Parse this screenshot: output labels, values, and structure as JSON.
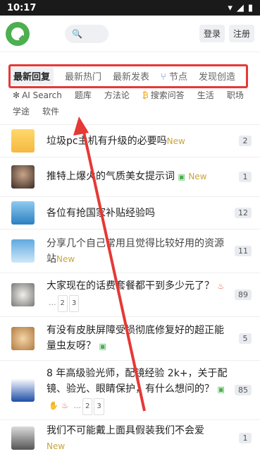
{
  "status": {
    "time": "10:17"
  },
  "header": {
    "login": "登录",
    "register": "注册"
  },
  "tabs": [
    "最新回复",
    "最新热门",
    "最新发表",
    "节点",
    "发现创造"
  ],
  "categories": [
    "AI Search",
    "题库",
    "方法论",
    "搜索问答",
    "生活",
    "职场",
    "学途",
    "软件"
  ],
  "topics": [
    {
      "title": "垃圾pc主机有升级的必要吗",
      "new": "New",
      "count": "2"
    },
    {
      "title": "推特上爆火的气质美女提示词",
      "new": "New",
      "count": "1"
    },
    {
      "title": "各位有抢国家补贴经验吗",
      "new": "",
      "count": "12"
    },
    {
      "title": "分享几个自己常用且觉得比较好用的资源站",
      "new": "New",
      "count": "11"
    },
    {
      "title": "大家现在的话费套餐都干到多少元了？",
      "new": "",
      "count": "89"
    },
    {
      "title": "有没有皮肤屏障受损彻底修复好的超正能量虫友呀？",
      "new": "",
      "count": "5"
    },
    {
      "title": "8 年高级验光师，配镜经验 2k+，关于配镜、验光、眼睛保护，有什么想问的？",
      "new": "",
      "count": "85"
    },
    {
      "title": "我们不可能戴上面具假装我们不会爱",
      "new": "New",
      "count": "1"
    }
  ],
  "pagination": {
    "dots": "...",
    "p2": "2",
    "p3": "3"
  },
  "colors": {
    "accent": "#4caf50",
    "annotation": "#e53935",
    "new": "#c9a63a"
  }
}
